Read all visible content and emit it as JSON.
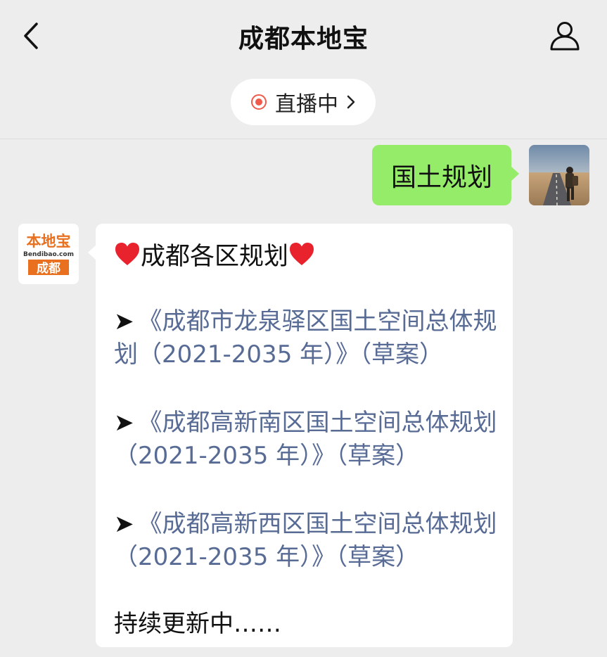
{
  "header": {
    "title": "成都本地宝",
    "live_label": "直播中"
  },
  "messages": {
    "outgoing_text": "国土规划",
    "incoming": {
      "heading": "成都各区规划",
      "links": [
        {
          "arrow": "➤",
          "text": "《成都市龙泉驿区国土空间总体规划（2021-2035 年）》（草案）"
        },
        {
          "arrow": "➤",
          "text": "《成都高新南区国土空间总体规划（2021-2035 年）》（草案）"
        },
        {
          "arrow": "➤",
          "text": "《成都高新西区国土空间总体规划（2021-2035 年）》（草案）"
        }
      ],
      "footer": "持续更新中……"
    }
  },
  "bot_avatar": {
    "brand_top": "本地宝",
    "brand_url": "Bendibao.com",
    "brand_city": "成都"
  },
  "colors": {
    "background": "#ededed",
    "outgoing_bubble": "#95ec69",
    "link": "#576b95",
    "live_dot": "#f05a4b",
    "brand_orange": "#e8701f",
    "heart": "#e8232e"
  },
  "icons": {
    "back": "chevron-left-icon",
    "profile": "user-icon",
    "live": "live-record-icon",
    "chevron": "chevron-right-icon",
    "heart": "heart-icon"
  }
}
